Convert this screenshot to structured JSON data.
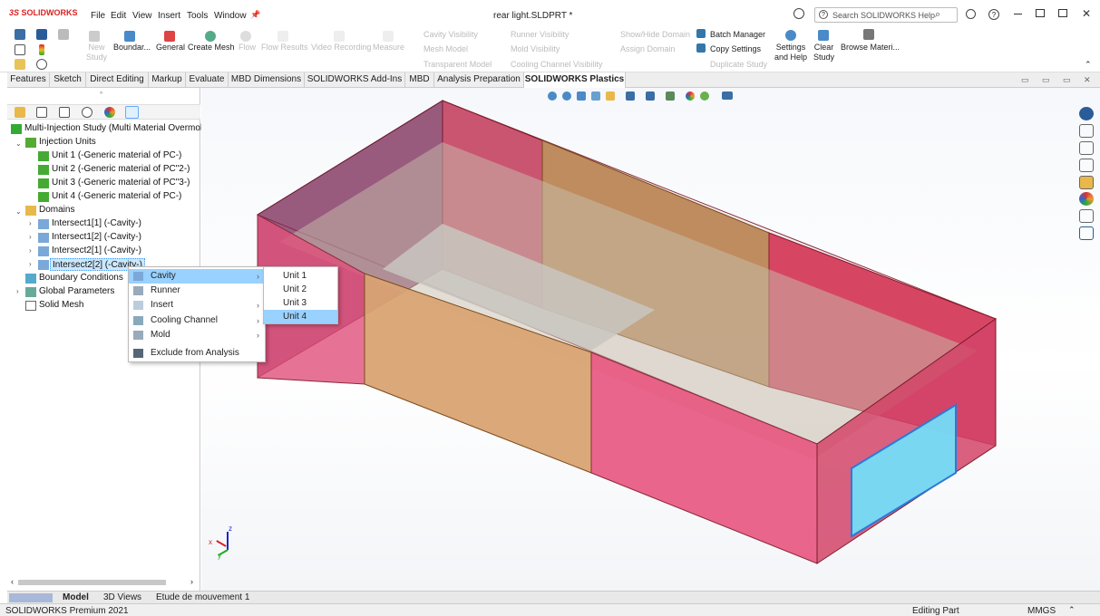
{
  "app": {
    "logo": "SOLIDWORKS",
    "menu": [
      "File",
      "Edit",
      "View",
      "Insert",
      "Tools",
      "Window"
    ],
    "doc_title": "rear light.SLDPRT *",
    "search_placeholder": "Search SOLIDWORKS Help"
  },
  "ribbon": {
    "new_study": "New\nStudy",
    "boundary": "Boundar...",
    "general": "General",
    "create_mesh": "Create Mesh",
    "flow": "Flow",
    "flow_results": "Flow Results",
    "video_recording": "Video Recording",
    "measure": "Measure",
    "cavity_visibility": "Cavity Visibility",
    "mesh_model": "Mesh Model",
    "transparent_model": "Transparent Model",
    "runner_visibility": "Runner Visibility",
    "mold_visibility": "Mold Visibility",
    "cooling_channel_visibility": "Cooling Channel Visibility",
    "show_hide_domain": "Show/Hide Domain",
    "assign_domain": "Assign Domain",
    "batch_manager": "Batch Manager",
    "copy_settings": "Copy Settings",
    "duplicate_study": "Duplicate Study",
    "settings_help": "Settings\nand Help",
    "clear_study": "Clear\nStudy",
    "browse_materials": "Browse Materi..."
  },
  "tabs": [
    "Features",
    "Sketch",
    "Direct Editing",
    "Markup",
    "Evaluate",
    "MBD Dimensions",
    "SOLIDWORKS Add-Ins",
    "MBD",
    "Analysis Preparation",
    "SOLIDWORKS Plastics"
  ],
  "tree": {
    "root": "Multi-Injection Study (Multi Material Overmolc",
    "injection_units": "Injection Units",
    "units": [
      "Unit 1 (-Generic material of PC-)",
      "Unit 2 (-Generic material of PC\"2-)",
      "Unit 3 (-Generic material of PC\"3-)",
      "Unit 4 (-Generic material of PC-)"
    ],
    "domains": "Domains",
    "intersects": [
      "Intersect1[1] (-Cavity-)",
      "Intersect1[2] (-Cavity-)",
      "Intersect2[1] (-Cavity-)",
      "Intersect2[2] (-Cavity-)"
    ],
    "boundary_conditions": "Boundary Conditions",
    "global_parameters": "Global Parameters",
    "solid_mesh": "Solid Mesh"
  },
  "context_menu": {
    "items": [
      "Cavity",
      "Runner",
      "Insert",
      "Cooling Channel",
      "Mold",
      "Exclude from Analysis"
    ],
    "submenu": [
      "Unit 1",
      "Unit 2",
      "Unit 3",
      "Unit 4"
    ]
  },
  "bottom_tabs": [
    "Model",
    "3D Views",
    "Etude de mouvement 1"
  ],
  "status": {
    "left": "SOLIDWORKS Premium 2021",
    "mode": "Editing Part",
    "units": "MMGS"
  },
  "triad": {
    "z": "z",
    "x": "x",
    "y": "y"
  }
}
